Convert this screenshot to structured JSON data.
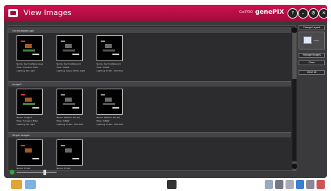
{
  "window": {
    "title": "View Images",
    "brand_small": "GelPRO",
    "brand": "genePIX",
    "buttons": [
      "?",
      "–",
      "⚙",
      "✕"
    ]
  },
  "groups": [
    {
      "name": "Gel multiplex.sgd",
      "images": [
        {
          "name": "Gel multiplex.jpeg",
          "filter": "Emission Filter",
          "lighting": "No Light",
          "labels": [
            "Name:",
            "Filter:",
            "Lighting:"
          ]
        },
        {
          "name": "Gel multiplex(1)",
          "filter": "RPNW",
          "lighting": "Upper White Light",
          "labels": [
            "Name:",
            "Filter:",
            "Lighting:"
          ]
        },
        {
          "name": "Gel multiplex(1)",
          "filter": "RPNW",
          "lighting": "R 4W - 504 Blue",
          "labels": [
            "Name:",
            "Filter:",
            "Lighting:"
          ]
        }
      ]
    },
    {
      "name": "Image3",
      "images": [
        {
          "name": "Image3",
          "filter": "Emission Filter",
          "lighting": "No Light",
          "labels": [
            "Name:",
            "Filter:",
            "Lighting:"
          ]
        },
        {
          "name": "Western Bio Kit",
          "filter": "RPNW",
          "lighting": "R 4W - 504 Blue",
          "labels": [
            "Name:",
            "Filter:",
            "Lighting:"
          ]
        },
        {
          "name": "Western Bio Kit",
          "filter": "RPNW",
          "lighting": "R 4W - 504 Blue",
          "labels": [
            "Name:",
            "Filter:",
            "Lighting:"
          ]
        }
      ]
    },
    {
      "name": "Single Images",
      "images": [
        {
          "name": "Ticket",
          "labels": [
            "Name:"
          ]
        },
        {
          "name": "Ticket",
          "labels": [
            "Name:"
          ]
        }
      ]
    }
  ],
  "side_panel": {
    "change_layout": "Change Layout",
    "layout_option": "View",
    "manage_images": "Manage Images",
    "close": "Close",
    "close_all": "Close All"
  },
  "zoom": {
    "level": 0.7
  }
}
